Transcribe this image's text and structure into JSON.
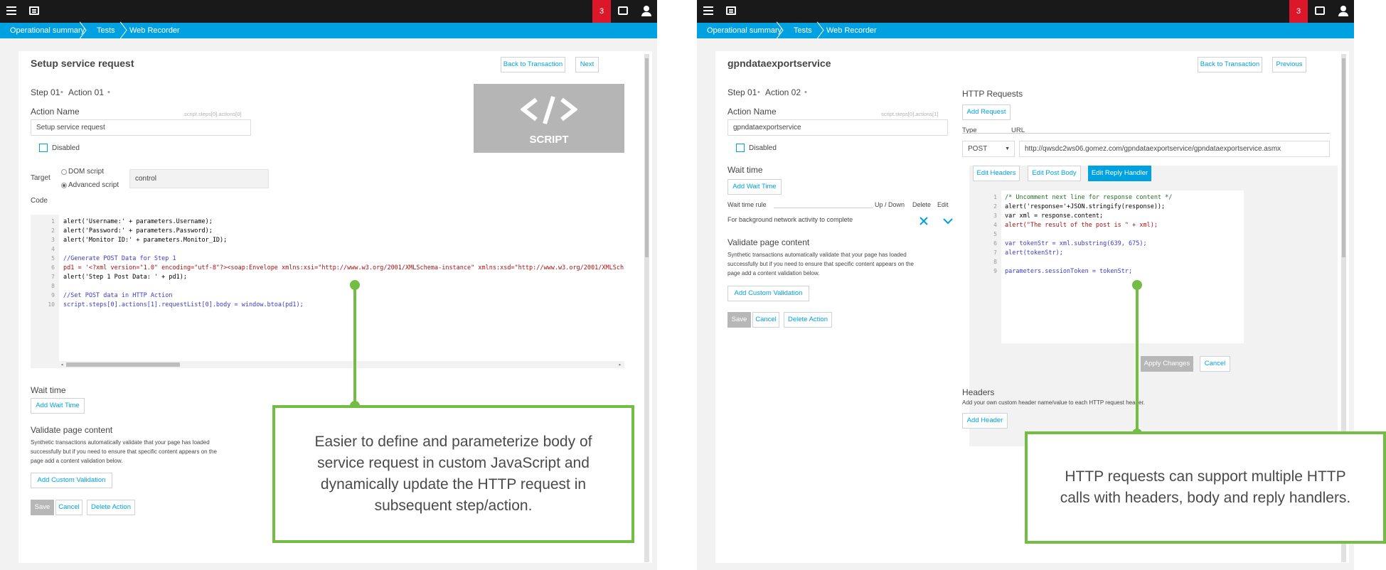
{
  "left": {
    "topbar": {
      "badge": "3"
    },
    "breadcrumb": [
      "Operational summary",
      "Tests",
      "Web Recorder"
    ],
    "title": "Setup service request",
    "back_button": "Back to Transaction",
    "nav_button": "Next",
    "step": "Step 01",
    "action": "Action 01",
    "action_name_label": "Action Name",
    "action_name_hint": "script.steps[0].actions[0]",
    "action_name_value": "Setup service request",
    "disabled_label": "Disabled",
    "target_label": "Target",
    "target_options": [
      "DOM script",
      "Advanced script"
    ],
    "target_value": "control",
    "code_label": "Code",
    "script_logo": "SCRIPT",
    "code_lines": [
      {
        "n": "1",
        "text": "alert('Username:' + parameters.Username);"
      },
      {
        "n": "2",
        "text": "alert('Password:' + parameters.Password);"
      },
      {
        "n": "3",
        "text": "alert('Monitor ID:' + parameters.Monitor_ID);"
      },
      {
        "n": "4",
        "text": ""
      },
      {
        "n": "5",
        "text": "//Generate POST Data for Step 1"
      },
      {
        "n": "6",
        "text": "pd1 = '<?xml version=\"1.0\" encoding=\"utf-8\"?><soap:Envelope xmlns:xsi=\"http://www.w3.org/2001/XMLSchema-instance\" xmlns:xsd=\"http://www.w3.org/2001/XMLSch"
      },
      {
        "n": "7",
        "text": "alert('Step 1 Post Data: ' + pd1);"
      },
      {
        "n": "8",
        "text": ""
      },
      {
        "n": "9",
        "text": "//Set POST data in HTTP Action"
      },
      {
        "n": "10",
        "text": "script.steps[0].actions[1].requestList[0].body = window.btoa(pd1);"
      }
    ],
    "wait_time_title": "Wait time",
    "add_wait_time": "Add Wait Time",
    "validate_title": "Validate page content",
    "validate_desc": "Synthetic transactions automatically validate that your page has loaded successfully but if you need to ensure that specific content appears on the page add a content validation below.",
    "add_custom_validation": "Add Custom Validation",
    "save": "Save",
    "cancel": "Cancel",
    "delete_action": "Delete Action",
    "callout": "Easier to define and parameterize body of service request in custom JavaScript and dynamically update the HTTP request in subsequent step/action."
  },
  "right": {
    "topbar": {
      "badge": "3"
    },
    "breadcrumb": [
      "Operational summary",
      "Tests",
      "Web Recorder"
    ],
    "title": "gpndataexportservice",
    "back_button": "Back to Transaction",
    "nav_button": "Previous",
    "step": "Step 01",
    "action": "Action 02",
    "action_name_label": "Action Name",
    "action_name_hint": "script.steps[0].actions[1]",
    "action_name_value": "gpndataexportservice",
    "disabled_label": "Disabled",
    "wait_time_title": "Wait time",
    "add_wait_time": "Add Wait Time",
    "wait_cols": [
      "Wait time rule",
      "Up / Down",
      "Delete",
      "Edit"
    ],
    "wait_row": "For background network activity to complete",
    "validate_title": "Validate page content",
    "validate_desc": "Synthetic transactions automatically validate that your page has loaded successfully but if you need to ensure that specific content appears on the page add a content validation below.",
    "add_custom_validation": "Add Custom Validation",
    "save": "Save",
    "cancel": "Cancel",
    "delete_action": "Delete Action",
    "http_title": "HTTP Requests",
    "add_request": "Add Request",
    "type_label": "Type",
    "url_label": "URL",
    "method": "POST",
    "url": "http://qwsdc2ws06.gomez.com/gpndataexportservice/gpndataexportservice.asmx",
    "edit_headers": "Edit Headers",
    "edit_post_body": "Edit Post Body",
    "edit_reply_handler": "Edit Reply Handler",
    "code_lines": [
      {
        "n": "1",
        "text": "/* Uncomment next line for response content */"
      },
      {
        "n": "2",
        "text": "alert('response='+JSON.stringify(response));"
      },
      {
        "n": "3",
        "text": "var xml = response.content;"
      },
      {
        "n": "4",
        "text": "alert(\"The result of the post is \" + xml);"
      },
      {
        "n": "5",
        "text": ""
      },
      {
        "n": "6",
        "text": "var tokenStr = xml.substring(639, 675);"
      },
      {
        "n": "7",
        "text": "alert(tokenStr);"
      },
      {
        "n": "8",
        "text": ""
      },
      {
        "n": "9",
        "text": "parameters.sessionToken = tokenStr;"
      }
    ],
    "apply_changes": "Apply Changes",
    "code_cancel": "Cancel",
    "headers_title": "Headers",
    "headers_desc": "Add your own custom header name/value to each HTTP request header.",
    "add_header": "Add Header",
    "callout": "HTTP requests can support multiple HTTP calls with headers, body and reply handlers."
  }
}
